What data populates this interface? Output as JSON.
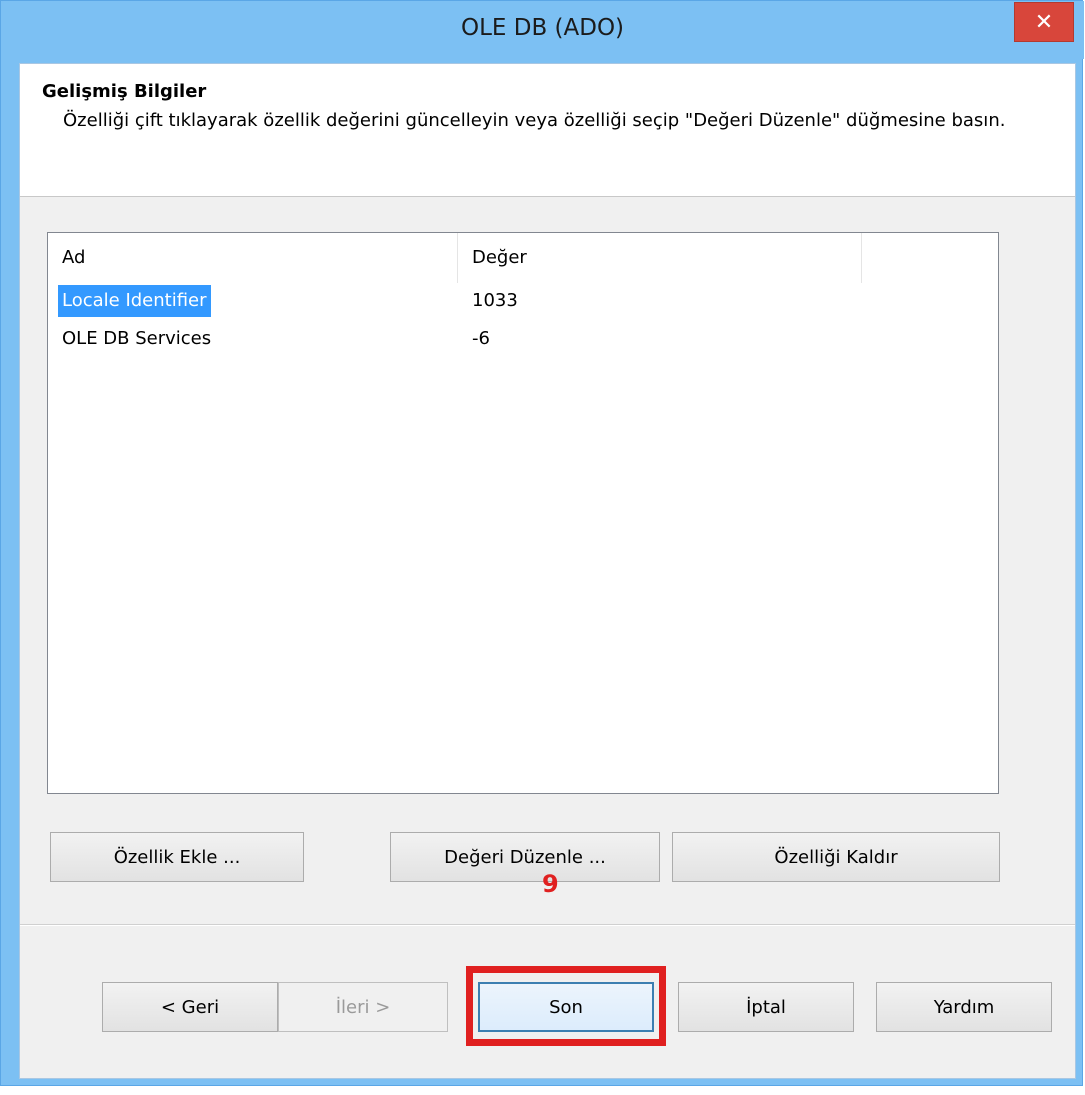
{
  "window": {
    "title": "OLE DB (ADO)",
    "close_glyph": "✕",
    "close_icon": "close-icon"
  },
  "header": {
    "title": "Gelişmiş Bilgiler",
    "description": "Özelliği çift tıklayarak özellik değerini güncelleyin veya özelliği seçip \"Değeri Düzenle\" düğmesine basın."
  },
  "list": {
    "columns": [
      "Ad",
      "Değer",
      ""
    ],
    "rows": [
      {
        "name": "Locale Identifier",
        "value": "1033",
        "selected": true
      },
      {
        "name": "OLE DB Services",
        "value": "-6",
        "selected": false
      }
    ]
  },
  "actions": {
    "add_label": "Özellik Ekle ...",
    "edit_label": "Değeri Düzenle ...",
    "remove_label": "Özelliği Kaldır"
  },
  "footer": {
    "back_label": "< Geri",
    "next_label": "İleri >",
    "finish_label": "Son",
    "cancel_label": "İptal",
    "help_label": "Yardım"
  },
  "annotation": {
    "step_number": "9",
    "color": "#e02020"
  },
  "colors": {
    "titlebar": "#7cc0f3",
    "close": "#d8463b",
    "selection": "#3399ff"
  }
}
